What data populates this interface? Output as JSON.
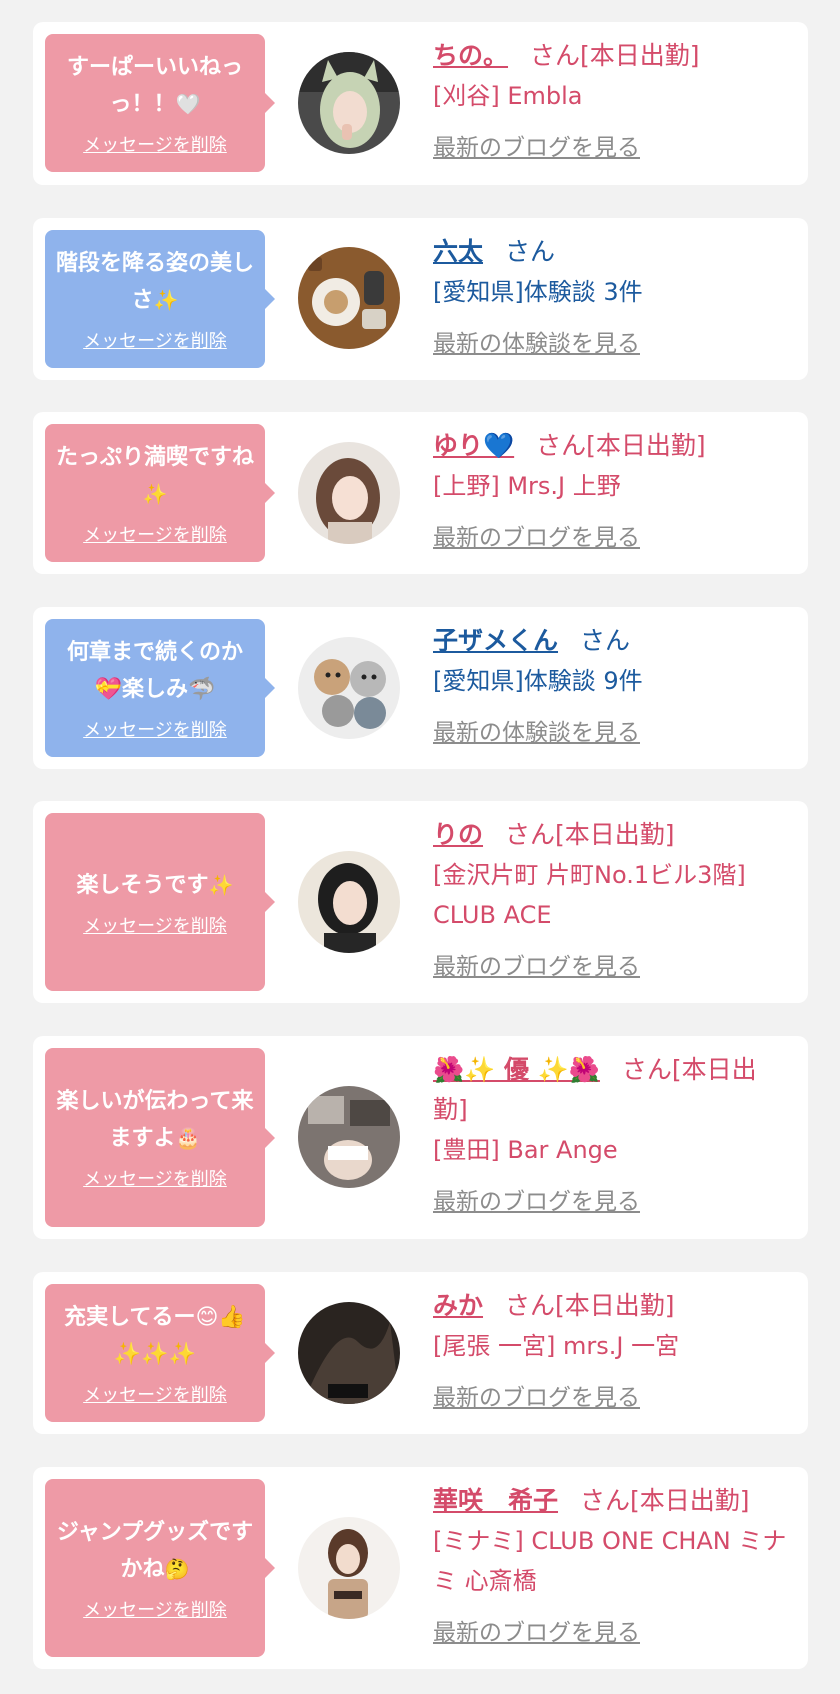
{
  "items": [
    {
      "message": "すーぱーいいねっっ！！",
      "message_emoji": "🤍",
      "delete_label": "メッセージを削除",
      "name": "ちの。",
      "name_suffix": "さん[本日出勤]",
      "detail": "[刈谷] Embla",
      "link_label": "最新のブログを見る",
      "avatar_icon": "avatar-photo"
    },
    {
      "message": "階段を降る姿の美しさ",
      "message_emoji": "✨",
      "delete_label": "メッセージを削除",
      "name": "六太",
      "name_suffix": "さん",
      "detail": "[愛知県]体験談 3件",
      "link_label": "最新の体験談を見る",
      "avatar_icon": "avatar-photo"
    },
    {
      "message": "たっぷり満喫ですね",
      "message_emoji": "✨",
      "delete_label": "メッセージを削除",
      "name": "ゆり💙",
      "name_suffix": "さん[本日出勤]",
      "detail": "[上野] Mrs.J 上野",
      "link_label": "最新のブログを見る",
      "avatar_icon": "avatar-photo"
    },
    {
      "message": "何章まで続くのか💝楽しみ🦈",
      "message_emoji": "",
      "delete_label": "メッセージを削除",
      "name": "子ザメくん",
      "name_suffix": "さん",
      "detail": "[愛知県]体験談 9件",
      "link_label": "最新の体験談を見る",
      "avatar_icon": "avatar-illustration"
    },
    {
      "message": "楽しそうです",
      "message_emoji": "✨",
      "delete_label": "メッセージを削除",
      "name": "りの",
      "name_suffix": "さん[本日出勤]",
      "detail": "[金沢片町 片町No.1ビル3階] CLUB ACE",
      "link_label": "最新のブログを見る",
      "avatar_icon": "avatar-photo"
    },
    {
      "message": "楽しいが伝わって来ますよ",
      "message_emoji": "🎂",
      "delete_label": "メッセージを削除",
      "name": "🌺✨ 優 ✨🌺",
      "name_suffix": "さん[本日出勤]",
      "detail": "[豊田] Bar Ange",
      "link_label": "最新のブログを見る",
      "avatar_icon": "avatar-photo"
    },
    {
      "message": "充実してるー😊👍✨✨✨",
      "message_emoji": "",
      "delete_label": "メッセージを削除",
      "name": "みか",
      "name_suffix": "さん[本日出勤]",
      "detail": "[尾張 一宮] mrs.J 一宮",
      "link_label": "最新のブログを見る",
      "avatar_icon": "avatar-photo"
    },
    {
      "message": "ジャンプグッズですかね",
      "message_emoji": "🤔",
      "delete_label": "メッセージを削除",
      "name": "華咲　希子",
      "name_suffix": "さん[本日出勤]",
      "detail": "[ミナミ] CLUB ONE CHAN ミナミ 心斎橋",
      "link_label": "最新のブログを見る",
      "avatar_icon": "avatar-photo"
    }
  ],
  "colors": {
    "pink_bubble": "#ee9aa6",
    "blue_bubble": "#8fb3ec",
    "pink_text": "#d44b6a",
    "blue_text": "#1c5a9e",
    "link_gray": "#8c8c8c",
    "background": "#f2f2f2"
  }
}
